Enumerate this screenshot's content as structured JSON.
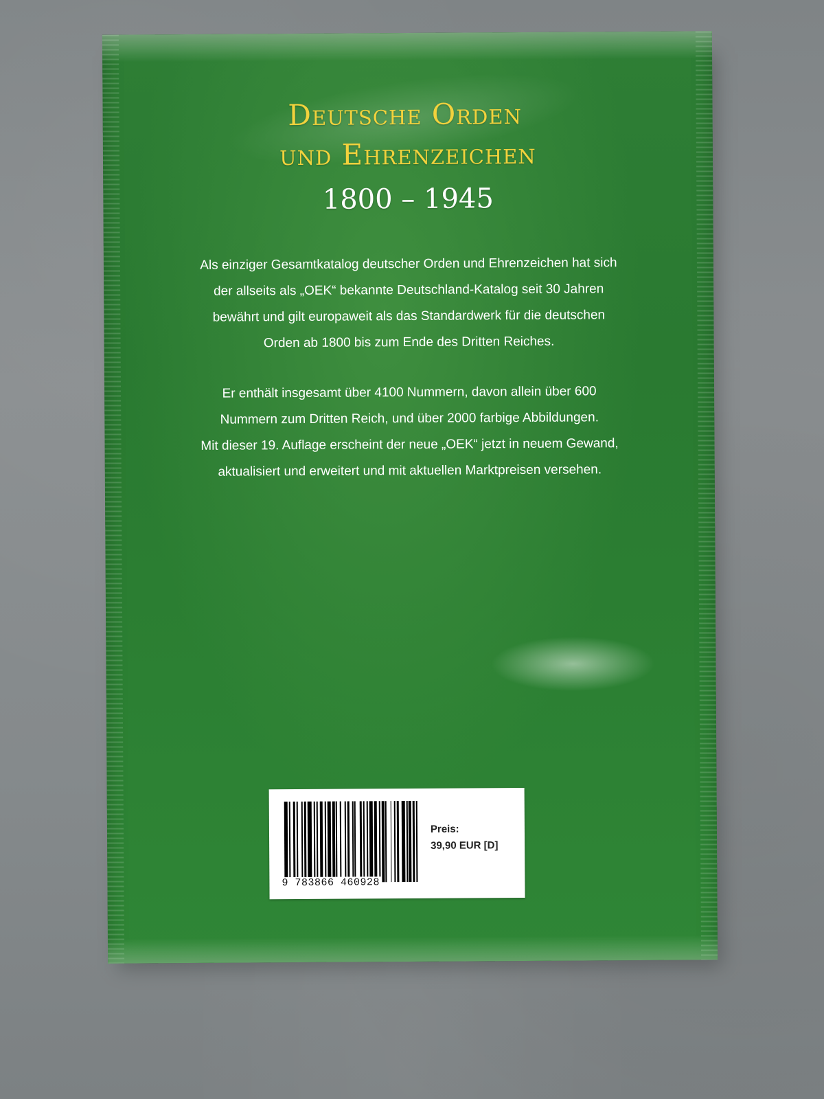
{
  "book": {
    "title_line_1": "Deutsche Orden",
    "title_line_2": "und Ehrenzeichen",
    "years": "1800 – 1945",
    "blurb_1": [
      "Als einziger Gesamtkatalog deutscher Orden und Ehrenzeichen hat sich",
      "der allseits als „OEK“ bekannte Deutschland-Katalog seit 30 Jahren",
      "bewährt und gilt europaweit als das Standardwerk für die deutschen",
      "Orden ab 1800 bis zum Ende des Dritten Reiches."
    ],
    "blurb_2": [
      "Er enthält insgesamt über 4100 Nummern, davon allein über 600",
      "Nummern zum Dritten Reich, und über 2000 farbige Abbildungen.",
      "Mit dieser 19. Auflage erscheint der neue „OEK“ jetzt in neuem Gewand,",
      "aktualisiert und erweitert und mit aktuellen Marktpreisen versehen."
    ]
  },
  "sticker": {
    "barcode_digits": "9 783866 460928",
    "price_label": "Preis:",
    "price_value": "39,90 EUR [D]"
  },
  "colors": {
    "cover_green": "#2b7e32",
    "title_yellow": "#f2d23d",
    "background_gray": "#858a8c"
  }
}
